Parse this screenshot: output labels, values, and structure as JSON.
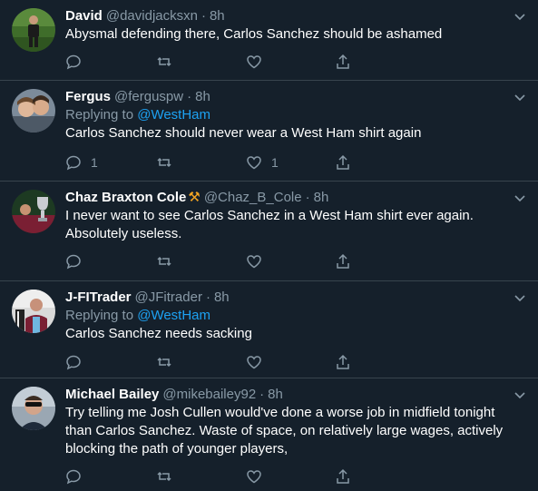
{
  "tweets": [
    {
      "name": "David",
      "badge": "",
      "handle": "@davidjacksxn",
      "time": "8h",
      "replying_label": "",
      "replying_to": "",
      "text": "Abysmal defending there, Carlos Sanchez should be ashamed",
      "reply_count": "",
      "like_count": "",
      "avatar_icon": "avatar-player-on-pitch"
    },
    {
      "name": "Fergus",
      "badge": "",
      "handle": "@ferguspw",
      "time": "8h",
      "replying_label": "Replying to ",
      "replying_to": "@WestHam",
      "text": "Carlos Sanchez should never wear a West Ham shirt again",
      "reply_count": "1",
      "like_count": "1",
      "avatar_icon": "avatar-couple-selfie"
    },
    {
      "name": "Chaz Braxton Cole",
      "badge": "⚒",
      "handle": "@Chaz_B_Cole",
      "time": "8h",
      "replying_label": "",
      "replying_to": "",
      "text": "I never want to see Carlos Sanchez in a West Ham shirt ever again. Absolutely useless.",
      "reply_count": "",
      "like_count": "",
      "avatar_icon": "avatar-trophy"
    },
    {
      "name": "J-FITrader",
      "badge": "",
      "handle": "@JFitrader",
      "time": "8h",
      "replying_label": "Replying to ",
      "replying_to": "@WestHam",
      "text": "Carlos Sanchez needs sacking",
      "reply_count": "",
      "like_count": "",
      "avatar_icon": "avatar-claret-shirt"
    },
    {
      "name": "Michael Bailey",
      "badge": "",
      "handle": "@mikebailey92",
      "time": "8h",
      "replying_label": "",
      "replying_to": "",
      "text": "Try telling me Josh Cullen would've done a worse job in midfield tonight than Carlos Sanchez. Waste of space, on relatively large wages, actively blocking the path of younger players,",
      "reply_count": "",
      "like_count": "",
      "avatar_icon": "avatar-man-sunglasses"
    }
  ],
  "colors": {
    "background": "#15202b",
    "divider": "#38444d",
    "secondary_text": "#8899a6",
    "link": "#1da1f2"
  }
}
